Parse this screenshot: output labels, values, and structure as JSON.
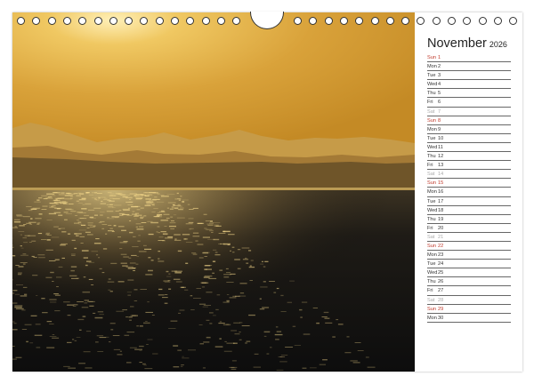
{
  "calendar": {
    "month": "November",
    "year": "2026",
    "days": [
      {
        "weekday": "Sun",
        "day": "1",
        "type": "sun"
      },
      {
        "weekday": "Mon",
        "day": "2",
        "type": "week"
      },
      {
        "weekday": "Tue",
        "day": "3",
        "type": "week"
      },
      {
        "weekday": "Wed",
        "day": "4",
        "type": "week"
      },
      {
        "weekday": "Thu",
        "day": "5",
        "type": "week"
      },
      {
        "weekday": "Fri",
        "day": "6",
        "type": "week"
      },
      {
        "weekday": "Sat",
        "day": "7",
        "type": "sat"
      },
      {
        "weekday": "Sun",
        "day": "8",
        "type": "sun"
      },
      {
        "weekday": "Mon",
        "day": "9",
        "type": "week"
      },
      {
        "weekday": "Tue",
        "day": "10",
        "type": "week"
      },
      {
        "weekday": "Wed",
        "day": "11",
        "type": "week"
      },
      {
        "weekday": "Thu",
        "day": "12",
        "type": "week"
      },
      {
        "weekday": "Fri",
        "day": "13",
        "type": "week"
      },
      {
        "weekday": "Sat",
        "day": "14",
        "type": "sat"
      },
      {
        "weekday": "Sun",
        "day": "15",
        "type": "sun"
      },
      {
        "weekday": "Mon",
        "day": "16",
        "type": "week"
      },
      {
        "weekday": "Tue",
        "day": "17",
        "type": "week"
      },
      {
        "weekday": "Wed",
        "day": "18",
        "type": "week"
      },
      {
        "weekday": "Thu",
        "day": "19",
        "type": "week"
      },
      {
        "weekday": "Fri",
        "day": "20",
        "type": "week"
      },
      {
        "weekday": "Sat",
        "day": "21",
        "type": "sat"
      },
      {
        "weekday": "Sun",
        "day": "22",
        "type": "sun"
      },
      {
        "weekday": "Mon",
        "day": "23",
        "type": "week"
      },
      {
        "weekday": "Tue",
        "day": "24",
        "type": "week"
      },
      {
        "weekday": "Wed",
        "day": "25",
        "type": "week"
      },
      {
        "weekday": "Thu",
        "day": "26",
        "type": "week"
      },
      {
        "weekday": "Fri",
        "day": "27",
        "type": "week"
      },
      {
        "weekday": "Sat",
        "day": "28",
        "type": "sat"
      },
      {
        "weekday": "Sun",
        "day": "29",
        "type": "sun"
      },
      {
        "weekday": "Mon",
        "day": "30",
        "type": "week"
      }
    ]
  },
  "photo": {
    "subject": "sunset-over-sea-with-mountains",
    "colors": {
      "sky_top": "#b8821c",
      "sky_glow": "#f0cf6c",
      "mountains": "#c29a45",
      "land": "#6a5228",
      "water": "#141414",
      "glitter": "#f4d88a"
    }
  },
  "colors": {
    "sunday": "#c0392b",
    "saturday": "#aaaaaa",
    "text": "#333333"
  },
  "binding": {
    "icons": [
      "ring-hole-icon",
      "hanger-cutout-icon"
    ]
  }
}
